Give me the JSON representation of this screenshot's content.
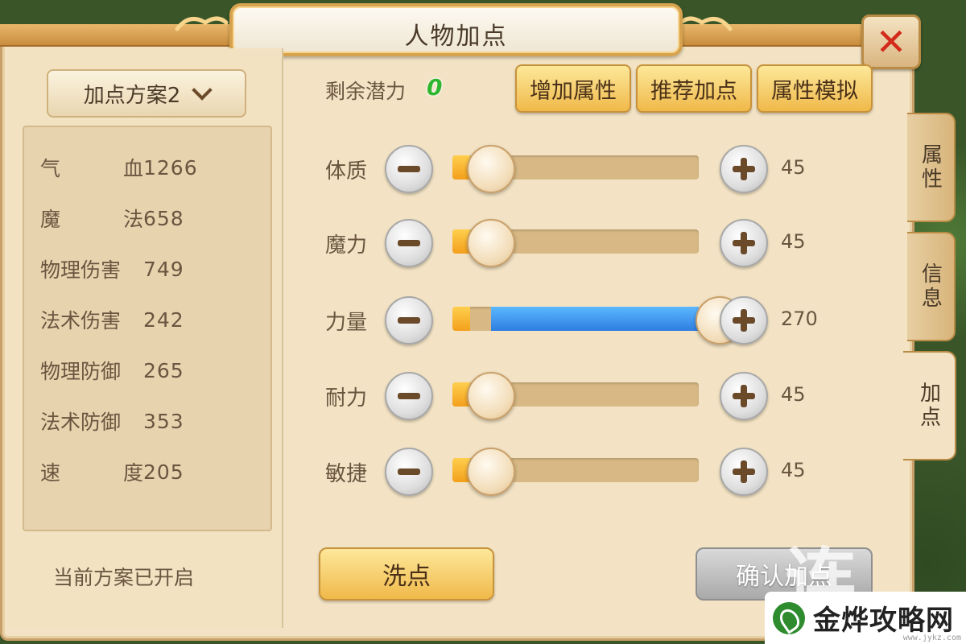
{
  "title": "人物加点",
  "scheme_select": {
    "label": "加点方案2"
  },
  "stats": [
    {
      "name_a": "气",
      "name_b": "血",
      "value": "1266"
    },
    {
      "name_a": "魔",
      "name_b": "法",
      "value": "658"
    },
    {
      "name": "物理伤害",
      "value": "749"
    },
    {
      "name": "法术伤害",
      "value": "242"
    },
    {
      "name": "物理防御",
      "value": "265"
    },
    {
      "name": "法术防御",
      "value": "353"
    },
    {
      "name_a": "速",
      "name_b": "度",
      "value": "205"
    }
  ],
  "scheme_status": "当前方案已开启",
  "potential": {
    "label": "剩余潜力",
    "value": "0"
  },
  "top_buttons": [
    "增加属性",
    "推荐加点",
    "属性模拟"
  ],
  "attributes": [
    {
      "label": "体质",
      "value": "45",
      "level": 0.0
    },
    {
      "label": "魔力",
      "value": "45",
      "level": 0.0
    },
    {
      "label": "力量",
      "value": "270",
      "level": 1.0
    },
    {
      "label": "耐力",
      "value": "45",
      "level": 0.0
    },
    {
      "label": "敏捷",
      "value": "45",
      "level": 0.0
    }
  ],
  "actions": {
    "wash": "洗点",
    "confirm": "确认加点"
  },
  "side_tabs": [
    "属性",
    "信息",
    "加点"
  ],
  "active_tab": "加点",
  "watermark": {
    "brand": "金烨攻略网",
    "url": "www.jykz.com"
  },
  "colors": {
    "accent": "#f0b94a",
    "potential": "#2fb52f",
    "slider_fill": "#2f7de0",
    "close": "#d22a1b"
  }
}
